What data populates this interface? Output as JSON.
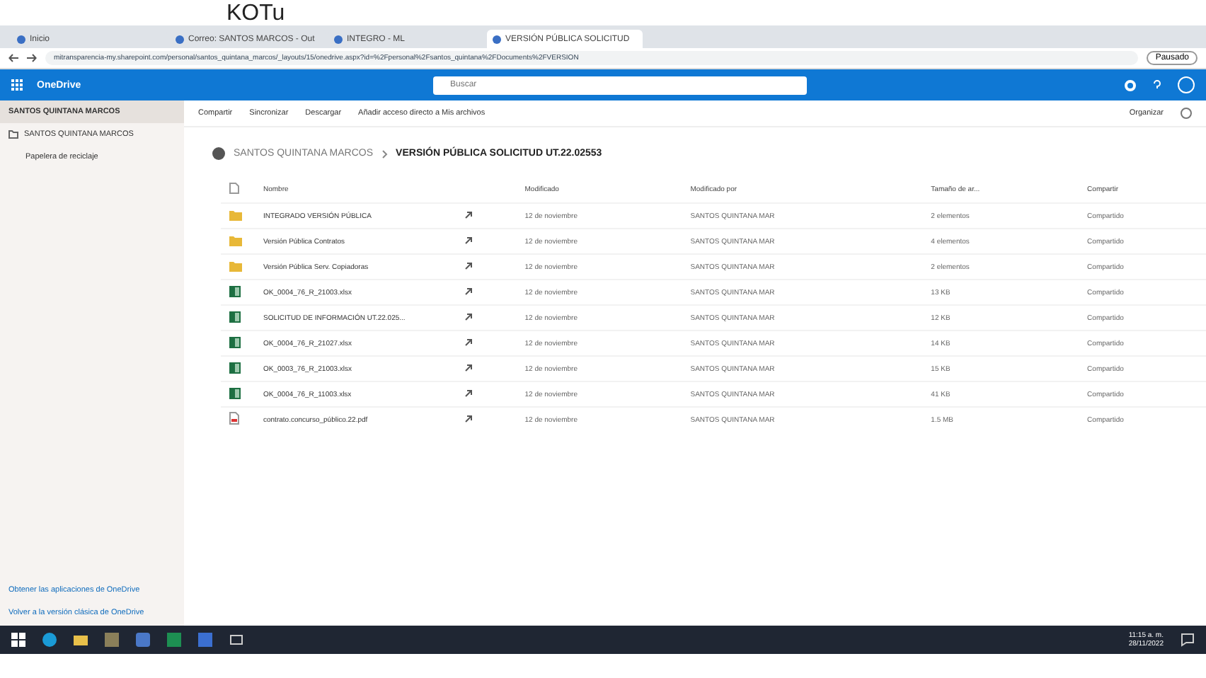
{
  "header_fragment": "KOTu",
  "browser": {
    "tabs": [
      {
        "label": "Inicio",
        "selected": false
      },
      {
        "label": "Correo: SANTOS MARCOS - Out",
        "selected": false
      },
      {
        "label": "INTEGRO - ML",
        "selected": false
      },
      {
        "label": "VERSIÓN PÚBLICA SOLICITUD",
        "selected": true
      }
    ],
    "url": "mitransparencia-my.sharepoint.com/personal/santos_quintana_marcos/_layouts/15/onedrive.aspx?id=%2Fpersonal%2Fsantos_quintana%2FDocuments%2FVERSION",
    "profile_button": "Pausado"
  },
  "app_bar": {
    "title": "OneDrive",
    "search": {
      "placeholder": "Buscar"
    }
  },
  "sidebar": {
    "items": [
      {
        "label": "SANTOS QUINTANA MARCOS",
        "selected": true,
        "kind": "header"
      },
      {
        "label": "SANTOS QUINTANA MARCOS",
        "selected": false,
        "kind": "folder"
      },
      {
        "label": "Papelera de reciclaje",
        "selected": false,
        "kind": "plain"
      }
    ],
    "footer_links": [
      "Obtener las aplicaciones de OneDrive",
      "Volver a la versión clásica de OneDrive"
    ]
  },
  "command_bar": {
    "actions": [
      "Compartir",
      "Sincronizar",
      "Descargar",
      "Añadir acceso directo a Mis archivos"
    ],
    "sort": "Organizar"
  },
  "breadcrumb": [
    "SANTOS QUINTANA MARCOS",
    "VERSIÓN PÚBLICA SOLICITUD UT.22.02553"
  ],
  "table": {
    "columns": [
      "Nombre",
      "Modificado",
      "Modificado por",
      "Tamaño de ar...",
      "Compartir"
    ],
    "rows": [
      {
        "kind": "folder",
        "name": "INTEGRADO VERSIÓN PÚBLICA",
        "modified": "12 de noviembre",
        "modified_by": "SANTOS QUINTANA MAR",
        "size": "2 elementos",
        "sharing": "Compartido"
      },
      {
        "kind": "folder",
        "name": "Versión Pública Contratos",
        "modified": "12 de noviembre",
        "modified_by": "SANTOS QUINTANA MAR",
        "size": "4 elementos",
        "sharing": "Compartido"
      },
      {
        "kind": "folder",
        "name": "Versión Pública Serv. Copiadoras",
        "modified": "12 de noviembre",
        "modified_by": "SANTOS QUINTANA MAR",
        "size": "2 elementos",
        "sharing": "Compartido"
      },
      {
        "kind": "excel",
        "name": "OK_0004_76_R_21003.xlsx",
        "modified": "12 de noviembre",
        "modified_by": "SANTOS QUINTANA MAR",
        "size": "13 KB",
        "sharing": "Compartido"
      },
      {
        "kind": "excel",
        "name": "SOLICITUD DE INFORMACIÓN UT.22.025...",
        "modified": "12 de noviembre",
        "modified_by": "SANTOS QUINTANA MAR",
        "size": "12 KB",
        "sharing": "Compartido"
      },
      {
        "kind": "excel",
        "name": "OK_0004_76_R_21027.xlsx",
        "modified": "12 de noviembre",
        "modified_by": "SANTOS QUINTANA MAR",
        "size": "14 KB",
        "sharing": "Compartido"
      },
      {
        "kind": "excel",
        "name": "OK_0003_76_R_21003.xlsx",
        "modified": "12 de noviembre",
        "modified_by": "SANTOS QUINTANA MAR",
        "size": "15 KB",
        "sharing": "Compartido"
      },
      {
        "kind": "excel",
        "name": "OK_0004_76_R_11003.xlsx",
        "modified": "12 de noviembre",
        "modified_by": "SANTOS QUINTANA MAR",
        "size": "41 KB",
        "sharing": "Compartido"
      },
      {
        "kind": "pdf",
        "name": "contrato.concurso_público.22.pdf",
        "modified": "12 de noviembre",
        "modified_by": "SANTOS QUINTANA MAR",
        "size": "1.5 MB",
        "sharing": "Compartido"
      }
    ]
  },
  "taskbar": {
    "time": "11:15 a. m.",
    "date": "28/11/2022"
  }
}
